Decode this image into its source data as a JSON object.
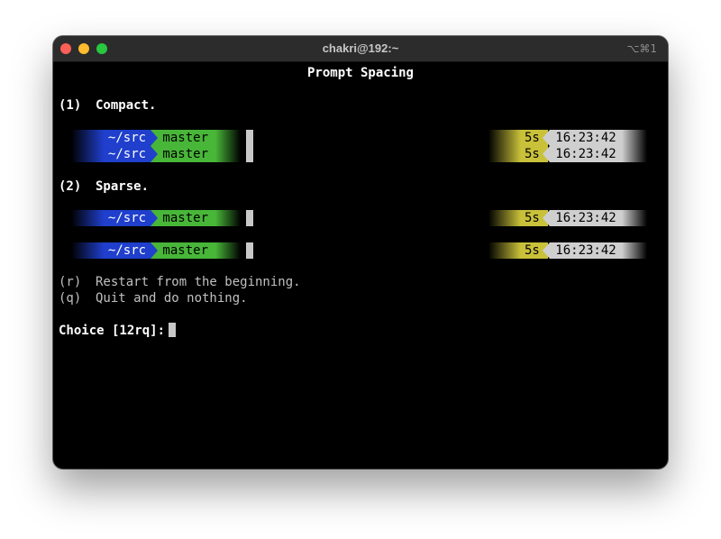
{
  "window": {
    "title": "chakri@192:~",
    "shortcut": "⌥⌘1"
  },
  "terminal": {
    "heading": "Prompt Spacing",
    "options": [
      {
        "num": "(1)",
        "label": "Compact."
      },
      {
        "num": "(2)",
        "label": "Sparse."
      }
    ],
    "prompt": {
      "dir": "~/src",
      "branch": "master",
      "duration": "5s",
      "time": "16:23:42"
    },
    "extra_options": [
      {
        "key": "(r)",
        "label": "Restart from the beginning."
      },
      {
        "key": "(q)",
        "label": "Quit and do nothing."
      }
    ],
    "choice_prompt": "Choice [12rq]:"
  },
  "colors": {
    "dir_bg": "#1f3fcc",
    "branch_bg": "#48b638",
    "duration_bg": "#c9c13a",
    "time_bg": "#cfcfcf"
  }
}
